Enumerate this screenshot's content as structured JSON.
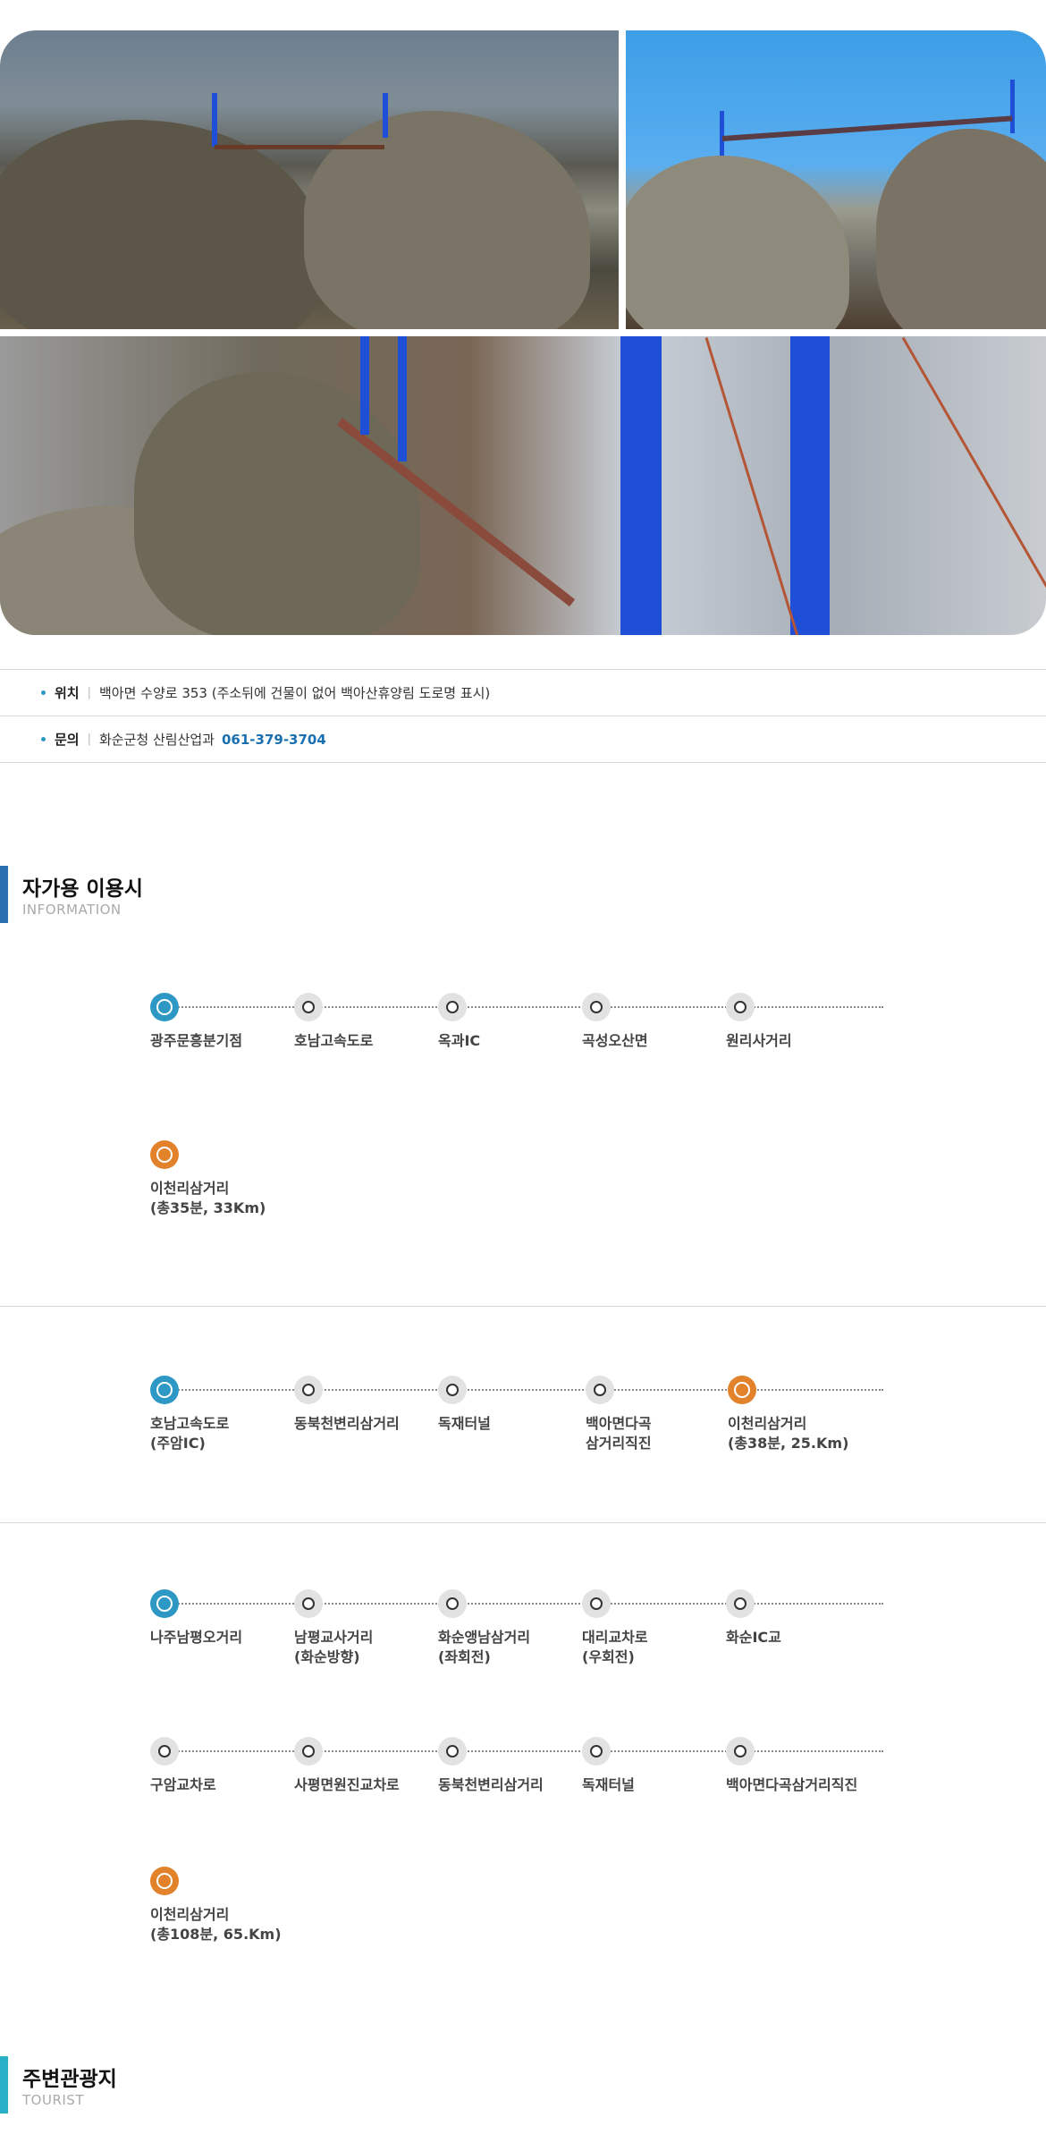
{
  "info": {
    "location_label": "위치",
    "location_value": "백아면 수양로 353 (주소뒤에 건물이 없어 백아산휴양림 도로명 표시)",
    "contact_label": "문의",
    "contact_value": "화순군청 산림산업과",
    "contact_phone": "061-379-3704"
  },
  "section_car": {
    "title": "자가용 이용시",
    "subtitle": "INFORMATION"
  },
  "section_tourist": {
    "title": "주변관광지",
    "subtitle": "TOURIST"
  },
  "routes": [
    {
      "rows": [
        [
          {
            "label": "광주문흥분기점",
            "type": "start"
          },
          {
            "label": "호남고속도로",
            "type": "mid"
          },
          {
            "label": "옥과IC",
            "type": "mid"
          },
          {
            "label": "곡성오산면",
            "type": "mid"
          },
          {
            "label": "원리사거리",
            "type": "mid"
          }
        ],
        [
          {
            "label": "이천리삼거리\n(총35분, 33Km)",
            "type": "end"
          }
        ]
      ]
    },
    {
      "rows": [
        [
          {
            "label": "호남고속도로\n(주암IC)",
            "type": "start"
          },
          {
            "label": "동북천변리삼거리",
            "type": "mid"
          },
          {
            "label": "독재터널",
            "type": "mid"
          },
          {
            "label": "백아면다곡\n삼거리직진",
            "type": "mid"
          },
          {
            "label": "이천리삼거리\n(총38분, 25.Km)",
            "type": "end"
          }
        ]
      ]
    },
    {
      "rows": [
        [
          {
            "label": "나주남평오거리",
            "type": "start"
          },
          {
            "label": "남평교사거리\n(화순방향)",
            "type": "mid"
          },
          {
            "label": "화순앵남삼거리\n(좌회전)",
            "type": "mid"
          },
          {
            "label": "대리교차로\n(우회전)",
            "type": "mid"
          },
          {
            "label": "화순IC교",
            "type": "mid"
          }
        ],
        [
          {
            "label": "구암교차로",
            "type": "mid"
          },
          {
            "label": "사평면원진교차로",
            "type": "mid"
          },
          {
            "label": "동북천변리삼거리",
            "type": "mid"
          },
          {
            "label": "독재터널",
            "type": "mid"
          },
          {
            "label": "백아면다곡삼거리직진",
            "type": "mid"
          }
        ],
        [
          {
            "label": "이천리삼거리\n(총108분, 65.Km)",
            "type": "end"
          }
        ]
      ]
    }
  ],
  "colors": {
    "accent_blue": "#2d98c4",
    "accent_orange": "#e2822a",
    "phone": "#1a6fb0",
    "section_bar": "#2a6fb0",
    "tourist_bar": "#2ab0c6"
  }
}
